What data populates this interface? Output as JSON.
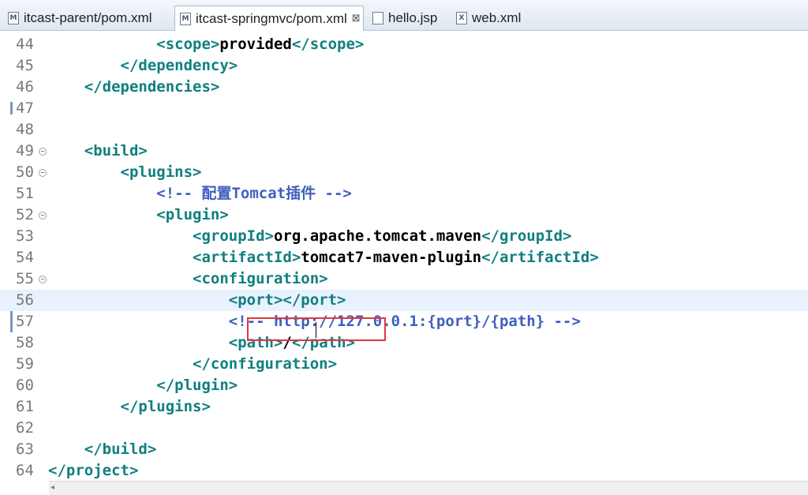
{
  "tabs": [
    {
      "label": "itcast-parent/pom.xml",
      "icon": "M",
      "active": false
    },
    {
      "label": "itcast-springmvc/pom.xml",
      "icon": "M",
      "active": true,
      "close": "⊠"
    },
    {
      "label": "hello.jsp",
      "icon": "jsp",
      "active": false
    },
    {
      "label": "web.xml",
      "icon": "X",
      "active": false
    }
  ],
  "lines": [
    {
      "n": "44",
      "fold": false,
      "parts": [
        [
          "tag",
          "            <scope>"
        ],
        [
          "txt",
          "provided"
        ],
        [
          "tag",
          "</scope>"
        ]
      ]
    },
    {
      "n": "45",
      "fold": false,
      "parts": [
        [
          "tag",
          "        </dependency>"
        ]
      ]
    },
    {
      "n": "46",
      "fold": false,
      "parts": [
        [
          "tag",
          "    </dependencies>"
        ]
      ]
    },
    {
      "n": "47",
      "fold": false,
      "parts": []
    },
    {
      "n": "48",
      "fold": false,
      "parts": []
    },
    {
      "n": "49",
      "fold": true,
      "parts": [
        [
          "tag",
          "    <build>"
        ]
      ]
    },
    {
      "n": "50",
      "fold": true,
      "parts": [
        [
          "tag",
          "        <plugins>"
        ]
      ]
    },
    {
      "n": "51",
      "fold": false,
      "parts": [
        [
          "cmt",
          "            <!-- 配置Tomcat插件 -->"
        ]
      ]
    },
    {
      "n": "52",
      "fold": true,
      "parts": [
        [
          "tag",
          "            <plugin>"
        ]
      ]
    },
    {
      "n": "53",
      "fold": false,
      "parts": [
        [
          "tag",
          "                <groupId>"
        ],
        [
          "txt",
          "org.apache.tomcat.maven"
        ],
        [
          "tag",
          "</groupId>"
        ]
      ]
    },
    {
      "n": "54",
      "fold": false,
      "parts": [
        [
          "tag",
          "                <artifactId>"
        ],
        [
          "txt",
          "tomcat7-maven-plugin"
        ],
        [
          "tag",
          "</artifactId>"
        ]
      ]
    },
    {
      "n": "55",
      "fold": true,
      "parts": [
        [
          "tag",
          "                <configuration>"
        ]
      ]
    },
    {
      "n": "56",
      "fold": false,
      "current": true,
      "parts": [
        [
          "tag",
          "                    <port></port>"
        ]
      ]
    },
    {
      "n": "57",
      "fold": false,
      "parts": [
        [
          "cmt",
          "                    <!-- http://127.0.0.1:{port}/{path} -->"
        ]
      ]
    },
    {
      "n": "58",
      "fold": false,
      "parts": [
        [
          "tag",
          "                    <path>"
        ],
        [
          "txt",
          "/"
        ],
        [
          "tag",
          "</path>"
        ]
      ]
    },
    {
      "n": "59",
      "fold": false,
      "parts": [
        [
          "tag",
          "                </configuration>"
        ]
      ]
    },
    {
      "n": "60",
      "fold": false,
      "parts": [
        [
          "tag",
          "            </plugin>"
        ]
      ]
    },
    {
      "n": "61",
      "fold": false,
      "parts": [
        [
          "tag",
          "        </plugins>"
        ]
      ]
    },
    {
      "n": "62",
      "fold": false,
      "parts": []
    },
    {
      "n": "63",
      "fold": false,
      "parts": [
        [
          "tag",
          "    </build>"
        ]
      ]
    },
    {
      "n": "64",
      "fold": false,
      "parts": [
        [
          "tag",
          "</project>"
        ]
      ]
    }
  ],
  "scroll_arrow": "◂"
}
